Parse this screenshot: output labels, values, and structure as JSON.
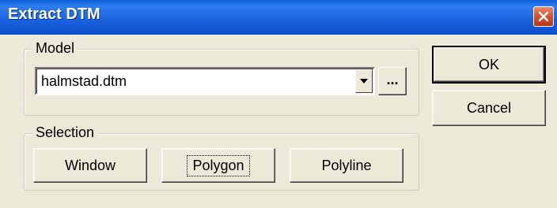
{
  "window": {
    "title": "Extract DTM",
    "close_icon": "close-icon"
  },
  "model": {
    "legend": "Model",
    "selected_value": "halmstad.dtm",
    "browse_label": "..."
  },
  "selection": {
    "legend": "Selection",
    "buttons": [
      "Window",
      "Polygon",
      "Polyline"
    ],
    "focused": "Polygon"
  },
  "actions": {
    "ok_label": "OK",
    "cancel_label": "Cancel"
  },
  "colors": {
    "titlebar": "#0b4fc9",
    "dialog_bg": "#ece9d8",
    "close_button": "#d5502c"
  }
}
